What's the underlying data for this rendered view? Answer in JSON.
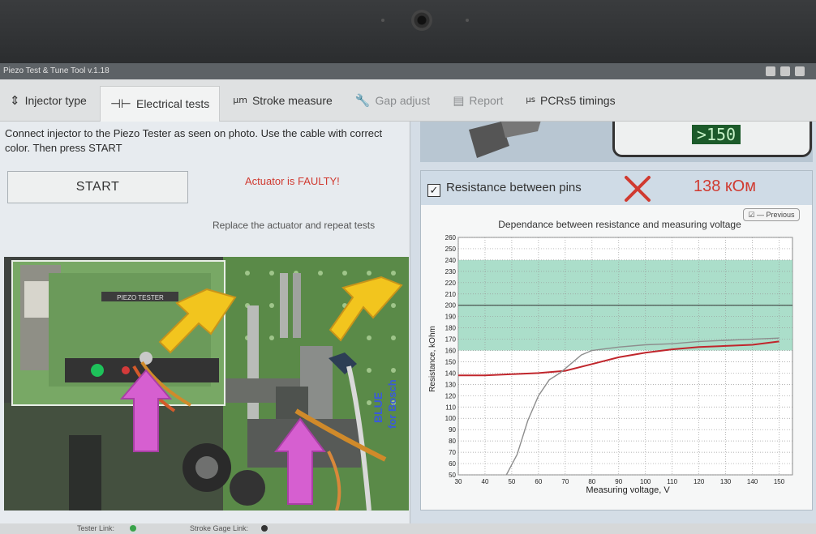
{
  "window": {
    "title": "Piezo Test & Tune Tool v.1.18"
  },
  "tabs": [
    {
      "label": "Injector type",
      "icon": "sliders-icon",
      "glyph": "⇕"
    },
    {
      "label": "Electrical tests",
      "icon": "resistor-icon",
      "glyph": "⊣⊢"
    },
    {
      "label": "Stroke measure",
      "icon": "micrometer-icon",
      "glyph": "μm"
    },
    {
      "label": "Gap adjust",
      "icon": "wrench-icon",
      "glyph": "🔧"
    },
    {
      "label": "Report",
      "icon": "report-icon",
      "glyph": "▤"
    },
    {
      "label": "PCRs5 timings",
      "icon": "timing-icon",
      "glyph": "μs"
    }
  ],
  "left": {
    "instruction": "Connect injector to the Piezo Tester as seen on photo. Use the cable with correct color. Then press START",
    "start_label": "START",
    "fault_message": "Actuator is FAULTY!",
    "advice": "Replace the actuator and repeat tests",
    "photo": {
      "device_label": "PIEZO TESTER",
      "cable_label_1": "BLUE",
      "cable_label_2": "for Bosch"
    }
  },
  "right": {
    "lcd_value": ">150",
    "resistance": {
      "checked": true,
      "title": "Resistance between pins",
      "value": "138 кОм",
      "status_icon": "fail-x-icon"
    },
    "previous_label": "Previous"
  },
  "status": {
    "tester_link": "Tester Link:",
    "stroke_link": "Stroke Gage Link:"
  },
  "colors": {
    "fault": "#d03a30",
    "band": "#8fd3b8",
    "current": "#c0262c",
    "previous": "#8d8d8d"
  },
  "chart_data": {
    "type": "line",
    "title": "Dependance between resistance and measuring voltage",
    "xlabel": "Measuring voltage, V",
    "ylabel": "Resistance, kOhm",
    "xlim": [
      30,
      155
    ],
    "ylim": [
      50,
      260
    ],
    "xticks": [
      30,
      40,
      50,
      60,
      70,
      80,
      90,
      100,
      110,
      120,
      130,
      140,
      150
    ],
    "yticks": [
      50,
      60,
      70,
      80,
      90,
      100,
      110,
      120,
      130,
      140,
      150,
      160,
      170,
      180,
      190,
      200,
      210,
      220,
      230,
      240,
      250,
      260
    ],
    "band": [
      160,
      240
    ],
    "reference": 200,
    "grid": true,
    "series": [
      {
        "name": "",
        "role": "current",
        "x": [
          30,
          40,
          50,
          60,
          70,
          80,
          90,
          100,
          110,
          120,
          130,
          140,
          150
        ],
        "y": [
          138,
          138,
          139,
          140,
          142,
          148,
          154,
          158,
          161,
          163,
          164,
          165,
          168
        ]
      },
      {
        "name": "Previous",
        "role": "previous",
        "x": [
          48,
          52,
          56,
          60,
          64,
          68,
          72,
          76,
          80,
          90,
          100,
          110,
          120,
          130,
          140,
          150
        ],
        "y": [
          50,
          68,
          98,
          120,
          134,
          140,
          148,
          156,
          160,
          163,
          165,
          166,
          168,
          169,
          170,
          171
        ]
      }
    ]
  }
}
